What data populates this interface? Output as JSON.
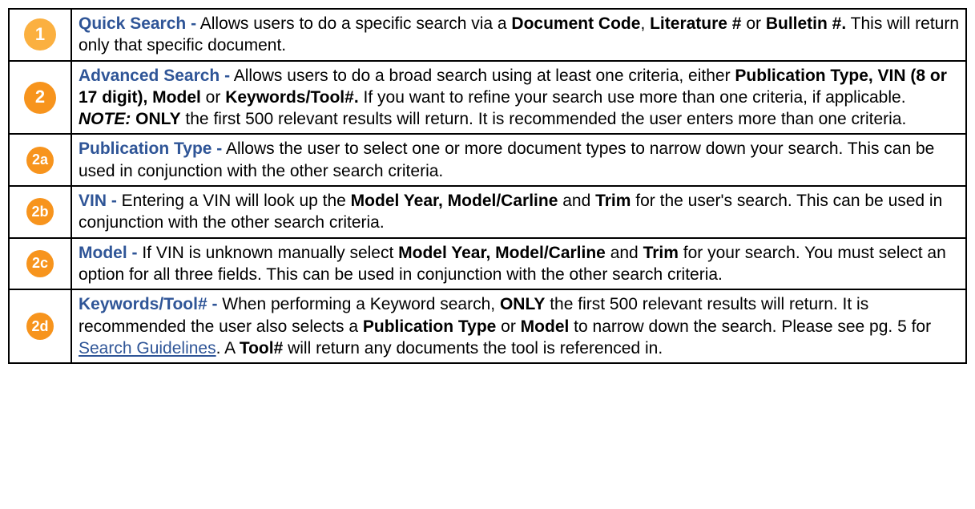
{
  "rows": [
    {
      "badge": "1",
      "badge_class": "badge light",
      "title": "Quick Search -",
      "pre": " Allows users to do a specific search via a ",
      "bold_parts": [
        "Document Code",
        "Literature #",
        "Bulletin #."
      ],
      "joins": [
        ", ",
        " or "
      ],
      "post": " This will return only that specific document."
    },
    {
      "badge": "2",
      "badge_class": "badge",
      "title": "Advanced Search -",
      "pre": " Allows users to do a broad search using at least one criteria, either ",
      "bold_parts": [
        "Publication Type, VIN (8 or 17 digit), Model",
        "Keywords/Tool#."
      ],
      "joins": [
        " or "
      ],
      "post": "  If you want to refine your search use more than one criteria, if applicable.",
      "note_label": "NOTE:",
      "note_bold": " ONLY",
      "note_text": " the first 500 relevant results will return. It is recommended the user enters more than one criteria."
    },
    {
      "badge": "2a",
      "badge_class": "badge small",
      "title": "Publication Type -",
      "simple_text": " Allows the user to select one or more document types to narrow down your search. This can be used in conjunction with the other search criteria."
    },
    {
      "badge": "2b",
      "badge_class": "badge small",
      "title": "VIN -",
      "pre": " Entering a VIN will look up the ",
      "bold_parts": [
        "Model Year, Model/Carline",
        "Trim"
      ],
      "joins": [
        " and "
      ],
      "post": " for the user's search. This can be used in conjunction with the other search criteria."
    },
    {
      "badge": "2c",
      "badge_class": "badge small",
      "title": "Model -",
      "pre": " If VIN is unknown manually select ",
      "bold_parts": [
        "Model Year, Model/Carline",
        "Trim"
      ],
      "joins": [
        " and "
      ],
      "post": " for your search. You must select an option for all three fields. This can be used in conjunction with the other search criteria."
    },
    {
      "badge": "2d",
      "badge_class": "badge small",
      "title": "Keywords/Tool# -",
      "kw_pre": " When performing a Keyword search, ",
      "kw_only": "ONLY",
      "kw_mid1": " the first 500 relevant results will return. It is recommended the user also selects a ",
      "kw_b1": "Publication Type",
      "kw_or": " or ",
      "kw_b2": "Model",
      "kw_mid2": " to narrow down the search. Please see pg. 5 for ",
      "kw_link": "Search Guidelines",
      "kw_mid3": ". A ",
      "kw_b3": "Tool#",
      "kw_post": " will return any documents the tool is referenced in."
    }
  ]
}
